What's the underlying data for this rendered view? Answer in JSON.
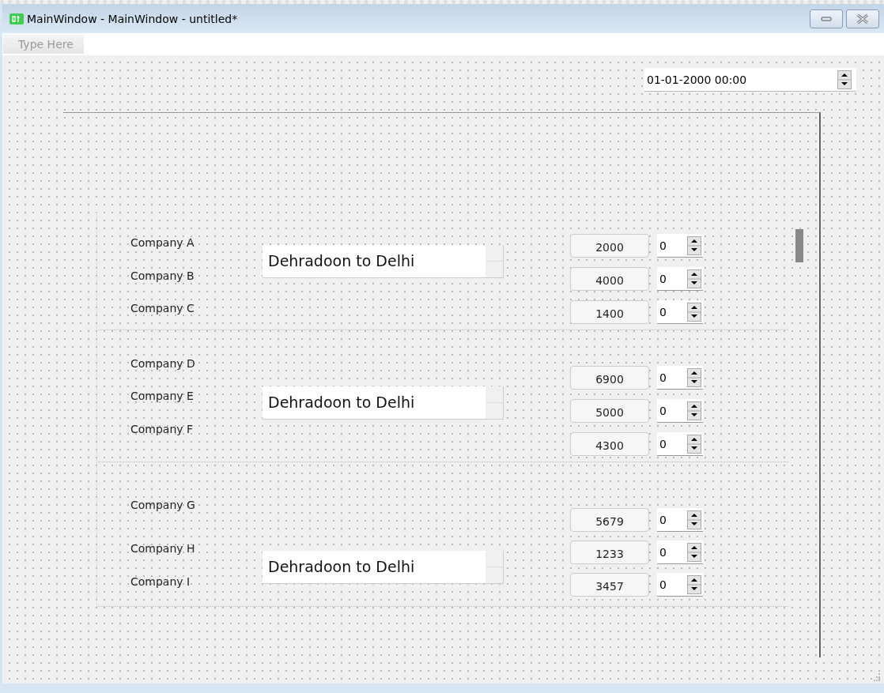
{
  "window": {
    "title": "MainWindow - MainWindow - untitled*"
  },
  "menu_bar": {
    "placeholder": "Type Here"
  },
  "datetime_edit": {
    "value": "01-01-2000 00:00"
  },
  "groups": [
    {
      "route": "Dehradoon to Delhi",
      "rows": [
        {
          "company": "Company A",
          "price": "2000",
          "quantity": "0"
        },
        {
          "company": "Company B",
          "price": "4000",
          "quantity": "0"
        },
        {
          "company": "Company C",
          "price": "1400",
          "quantity": "0"
        }
      ]
    },
    {
      "route": "Dehradoon to Delhi",
      "rows": [
        {
          "company": "Company D",
          "price": "6900",
          "quantity": "0"
        },
        {
          "company": "Company E",
          "price": "5000",
          "quantity": "0"
        },
        {
          "company": "Company F",
          "price": "4300",
          "quantity": "0"
        }
      ]
    },
    {
      "route": "Dehradoon to Delhi",
      "rows": [
        {
          "company": "Company G",
          "price": "5679",
          "quantity": "0"
        },
        {
          "company": "Company H",
          "price": "1233",
          "quantity": "0"
        },
        {
          "company": "Company I",
          "price": "3457",
          "quantity": "0"
        }
      ]
    }
  ]
}
